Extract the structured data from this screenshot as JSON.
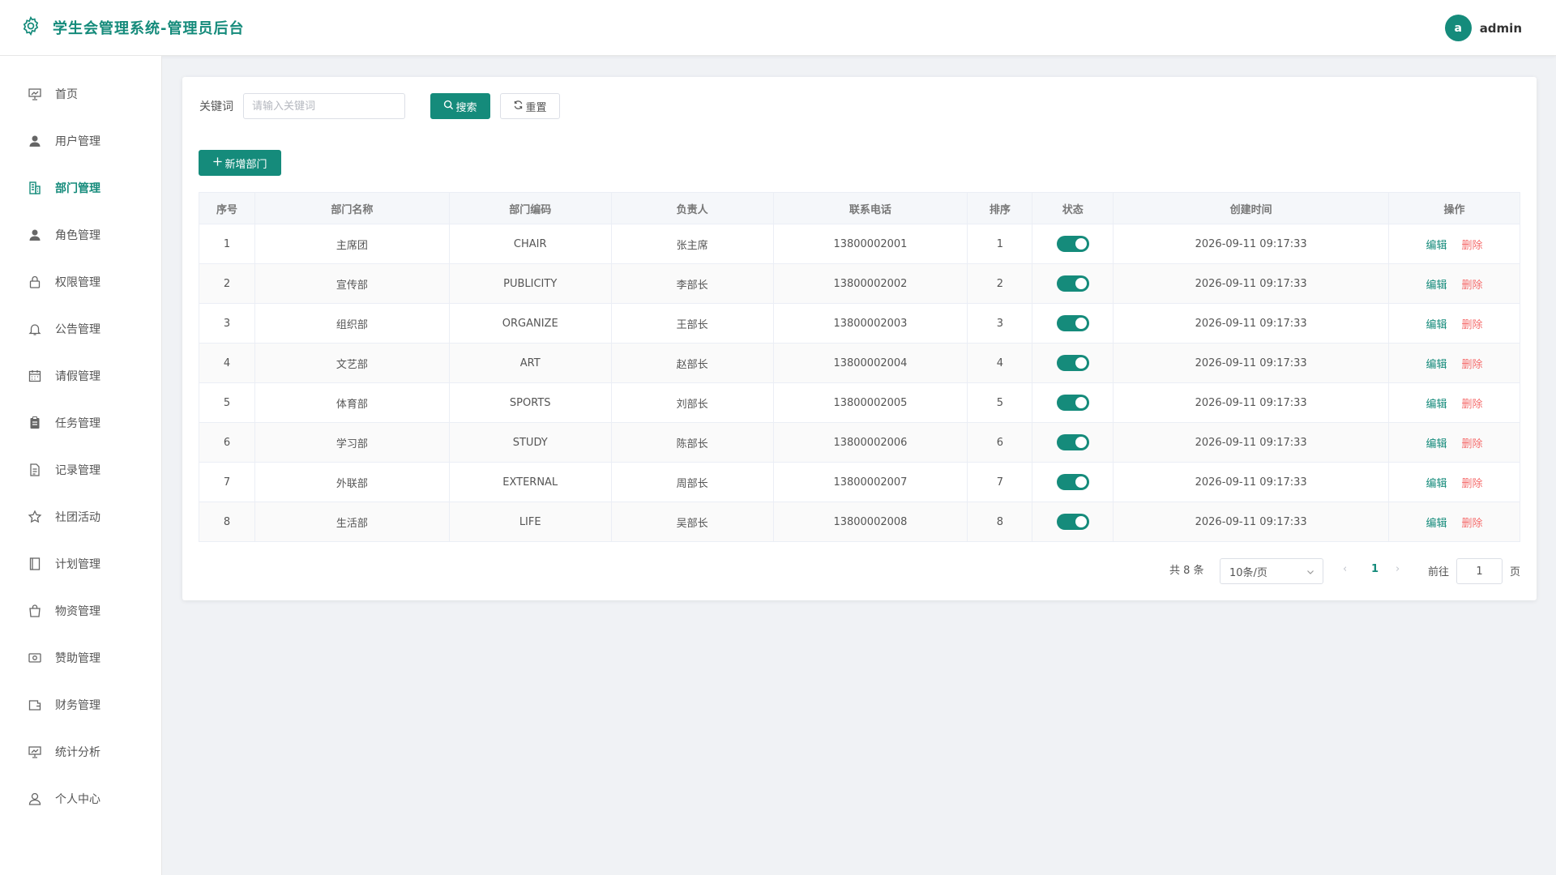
{
  "header": {
    "title": "学生会管理系统-管理员后台",
    "logo_icon": "gear-icon",
    "avatar_letter": "a",
    "username": "admin"
  },
  "sidebar": {
    "items": [
      {
        "label": "首页",
        "icon": "presentation-icon",
        "active": false
      },
      {
        "label": "用户管理",
        "icon": "user-icon",
        "active": false
      },
      {
        "label": "部门管理",
        "icon": "building-icon",
        "active": true
      },
      {
        "label": "角色管理",
        "icon": "user-icon",
        "active": false
      },
      {
        "label": "权限管理",
        "icon": "lock-icon",
        "active": false
      },
      {
        "label": "公告管理",
        "icon": "bell-icon",
        "active": false
      },
      {
        "label": "请假管理",
        "icon": "calendar-icon",
        "active": false
      },
      {
        "label": "任务管理",
        "icon": "clipboard-icon",
        "active": false
      },
      {
        "label": "记录管理",
        "icon": "document-icon",
        "active": false
      },
      {
        "label": "社团活动",
        "icon": "star-icon",
        "active": false
      },
      {
        "label": "计划管理",
        "icon": "notebook-icon",
        "active": false
      },
      {
        "label": "物资管理",
        "icon": "bag-icon",
        "active": false
      },
      {
        "label": "赞助管理",
        "icon": "money-icon",
        "active": false
      },
      {
        "label": "财务管理",
        "icon": "wallet-icon",
        "active": false
      },
      {
        "label": "统计分析",
        "icon": "chart-icon",
        "active": false
      },
      {
        "label": "个人中心",
        "icon": "user-outline-icon",
        "active": false
      }
    ]
  },
  "search": {
    "label": "关键词",
    "placeholder": "请输入关键词",
    "value": "",
    "search_button": "搜索",
    "reset_button": "重置"
  },
  "toolbar": {
    "add_button": "新增部门"
  },
  "table": {
    "columns": [
      "序号",
      "部门名称",
      "部门编码",
      "负责人",
      "联系电话",
      "排序",
      "状态",
      "创建时间",
      "操作"
    ],
    "edit_label": "编辑",
    "delete_label": "删除",
    "rows": [
      {
        "index": "1",
        "name": "主席团",
        "code": "CHAIR",
        "leader": "张主席",
        "phone": "13800002001",
        "sort": "1",
        "enabled": true,
        "created": "2026-09-11 09:17:33"
      },
      {
        "index": "2",
        "name": "宣传部",
        "code": "PUBLICITY",
        "leader": "李部长",
        "phone": "13800002002",
        "sort": "2",
        "enabled": true,
        "created": "2026-09-11 09:17:33"
      },
      {
        "index": "3",
        "name": "组织部",
        "code": "ORGANIZE",
        "leader": "王部长",
        "phone": "13800002003",
        "sort": "3",
        "enabled": true,
        "created": "2026-09-11 09:17:33"
      },
      {
        "index": "4",
        "name": "文艺部",
        "code": "ART",
        "leader": "赵部长",
        "phone": "13800002004",
        "sort": "4",
        "enabled": true,
        "created": "2026-09-11 09:17:33"
      },
      {
        "index": "5",
        "name": "体育部",
        "code": "SPORTS",
        "leader": "刘部长",
        "phone": "13800002005",
        "sort": "5",
        "enabled": true,
        "created": "2026-09-11 09:17:33"
      },
      {
        "index": "6",
        "name": "学习部",
        "code": "STUDY",
        "leader": "陈部长",
        "phone": "13800002006",
        "sort": "6",
        "enabled": true,
        "created": "2026-09-11 09:17:33"
      },
      {
        "index": "7",
        "name": "外联部",
        "code": "EXTERNAL",
        "leader": "周部长",
        "phone": "13800002007",
        "sort": "7",
        "enabled": true,
        "created": "2026-09-11 09:17:33"
      },
      {
        "index": "8",
        "name": "生活部",
        "code": "LIFE",
        "leader": "吴部长",
        "phone": "13800002008",
        "sort": "8",
        "enabled": true,
        "created": "2026-09-11 09:17:33"
      }
    ]
  },
  "pagination": {
    "total_text": "共 8 条",
    "page_size": "10条/页",
    "current_page": "1",
    "goto_label": "前往",
    "goto_value": "1",
    "page_suffix": "页"
  },
  "colors": {
    "accent": "#158b7b",
    "danger": "#f56c6c"
  }
}
